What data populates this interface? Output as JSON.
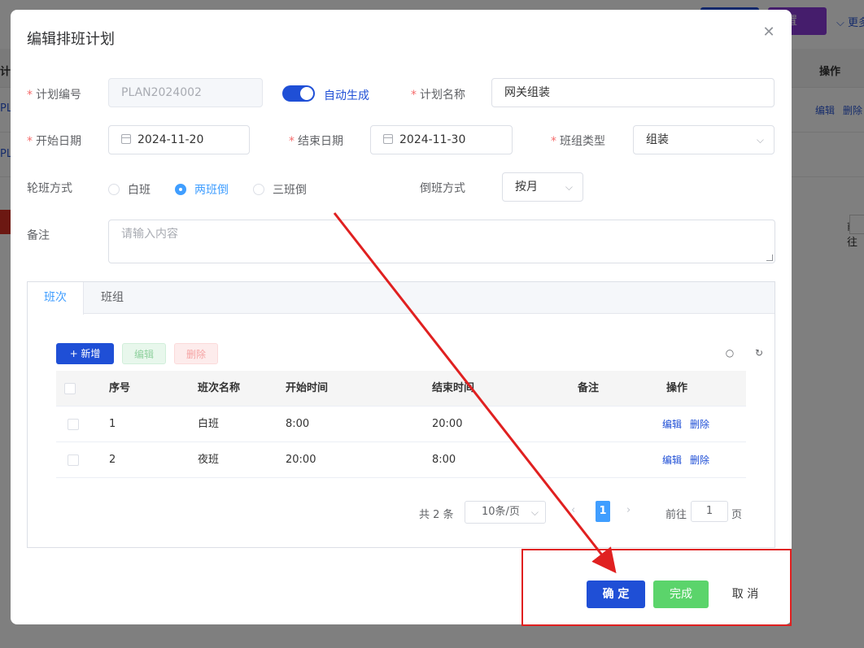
{
  "background": {
    "reset_button": "重置",
    "more_link": "更多",
    "table_header_op": "操作",
    "left_cut_1": "计",
    "left_cut_2": "PL",
    "left_cut_3": "PL",
    "row_edit": "编辑",
    "row_delete": "删除",
    "goto_label": "前往"
  },
  "dialog": {
    "title": "编辑排班计划",
    "close_icon": "close-icon"
  },
  "form": {
    "plan_no": {
      "label": "计划编号",
      "value": "PLAN2024002"
    },
    "auto_generate": {
      "label": "自动生成",
      "on": true
    },
    "plan_name": {
      "label": "计划名称",
      "value": "网关组装"
    },
    "start_date": {
      "label": "开始日期",
      "value": "2024-11-20"
    },
    "end_date": {
      "label": "结束日期",
      "value": "2024-11-30"
    },
    "team_type": {
      "label": "班组类型",
      "value": "组装"
    },
    "rotation": {
      "label": "轮班方式",
      "options": [
        "白班",
        "两班倒",
        "三班倒"
      ],
      "selected": "两班倒"
    },
    "shift_mode": {
      "label": "倒班方式",
      "value": "按月"
    },
    "remark": {
      "label": "备注",
      "placeholder": "请输入内容"
    }
  },
  "tabs": [
    {
      "label": "班次",
      "active": true
    },
    {
      "label": "班组",
      "active": false
    }
  ],
  "toolbar": {
    "add": "+ 新增",
    "edit": "编辑",
    "delete": "删除"
  },
  "table": {
    "columns": [
      "序号",
      "班次名称",
      "开始时间",
      "结束时间",
      "备注",
      "操作"
    ],
    "rows": [
      {
        "no": "1",
        "name": "白班",
        "start": "8:00",
        "end": "20:00",
        "remark": "",
        "edit": "编辑",
        "delete": "删除"
      },
      {
        "no": "2",
        "name": "夜班",
        "start": "20:00",
        "end": "8:00",
        "remark": "",
        "edit": "编辑",
        "delete": "删除"
      }
    ]
  },
  "pagination": {
    "total": "共 2 条",
    "page_size": "10条/页",
    "current_page": "1",
    "goto_label": "前往",
    "goto_value": "1",
    "page_suffix": "页"
  },
  "footer": {
    "confirm": "确 定",
    "done": "完成",
    "cancel": "取 消"
  },
  "colors": {
    "primary": "#1f4fd6",
    "success": "#5bd46b",
    "annotation": "#e02020",
    "link": "#409eff"
  }
}
